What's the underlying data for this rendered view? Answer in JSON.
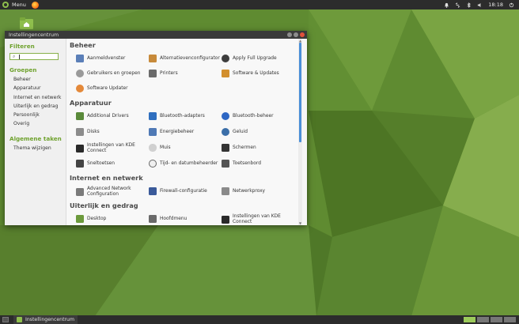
{
  "panel": {
    "menu_label": "Menu",
    "time": "18:18",
    "tray_icons": [
      "bell-icon",
      "network-icon",
      "bluetooth-icon",
      "volume-icon",
      "power-icon"
    ]
  },
  "window": {
    "title": "Instellingencentrum",
    "controls": [
      "minimize",
      "maximize",
      "close"
    ]
  },
  "sidebar": {
    "filter_heading": "Filteren",
    "search_value": "",
    "groups_heading": "Groepen",
    "groups": [
      "Beheer",
      "Apparatuur",
      "Internet en netwerk",
      "Uiterlijk en gedrag",
      "Persoonlijk",
      "Overig"
    ],
    "tasks_heading": "Algemene taken",
    "tasks": [
      "Thema wijzigen"
    ]
  },
  "categories": [
    {
      "title": "Beheer",
      "items": [
        {
          "label": "Aanmeldvenster",
          "icon": "login-window-icon"
        },
        {
          "label": "Alternatievenconfigurator",
          "icon": "alternatives-icon"
        },
        {
          "label": "Apply Full Upgrade",
          "icon": "upgrade-icon"
        },
        {
          "label": "Gebruikers en groepen",
          "icon": "users-icon"
        },
        {
          "label": "Printers",
          "icon": "printer-icon"
        },
        {
          "label": "Software & Updates",
          "icon": "software-icon"
        },
        {
          "label": "Software Updater",
          "icon": "updater-icon"
        }
      ]
    },
    {
      "title": "Apparatuur",
      "items": [
        {
          "label": "Additional Drivers",
          "icon": "drivers-icon"
        },
        {
          "label": "Bluetooth-adapters",
          "icon": "bluetooth-adapter-icon"
        },
        {
          "label": "Bluetooth-beheer",
          "icon": "bluetooth-manager-icon"
        },
        {
          "label": "Disks",
          "icon": "disks-icon"
        },
        {
          "label": "Energiebeheer",
          "icon": "power-manager-icon"
        },
        {
          "label": "Geluid",
          "icon": "sound-icon"
        },
        {
          "label": "Instellingen van KDE Connect",
          "icon": "kde-connect-icon"
        },
        {
          "label": "Muis",
          "icon": "mouse-icon"
        },
        {
          "label": "Schermen",
          "icon": "display-icon"
        },
        {
          "label": "Sneltoetsen",
          "icon": "shortcuts-icon"
        },
        {
          "label": "Tijd- en datumbeheerder",
          "icon": "clock-icon"
        },
        {
          "label": "Toetsenbord",
          "icon": "keyboard-icon"
        }
      ]
    },
    {
      "title": "Internet en netwerk",
      "items": [
        {
          "label": "Advanced Network Configuration",
          "icon": "network-config-icon"
        },
        {
          "label": "Firewall-configuratie",
          "icon": "firewall-icon"
        },
        {
          "label": "Netwerkproxy",
          "icon": "proxy-icon"
        }
      ]
    },
    {
      "title": "Uiterlijk en gedrag",
      "items": [
        {
          "label": "Desktop",
          "icon": "desktop-icon"
        },
        {
          "label": "Hoofdmenu",
          "icon": "main-menu-icon"
        },
        {
          "label": "Instellingen van KDE Connect",
          "icon": "kde-connect-icon"
        }
      ]
    }
  ],
  "taskbar": {
    "task_label": "Instellingencentrum",
    "workspaces": 4
  },
  "colors": {
    "accent": "#87b04a",
    "panel": "#2c2c2c",
    "desktop": "#5e8a30",
    "scroll_thumb": "#4a8fd8"
  }
}
